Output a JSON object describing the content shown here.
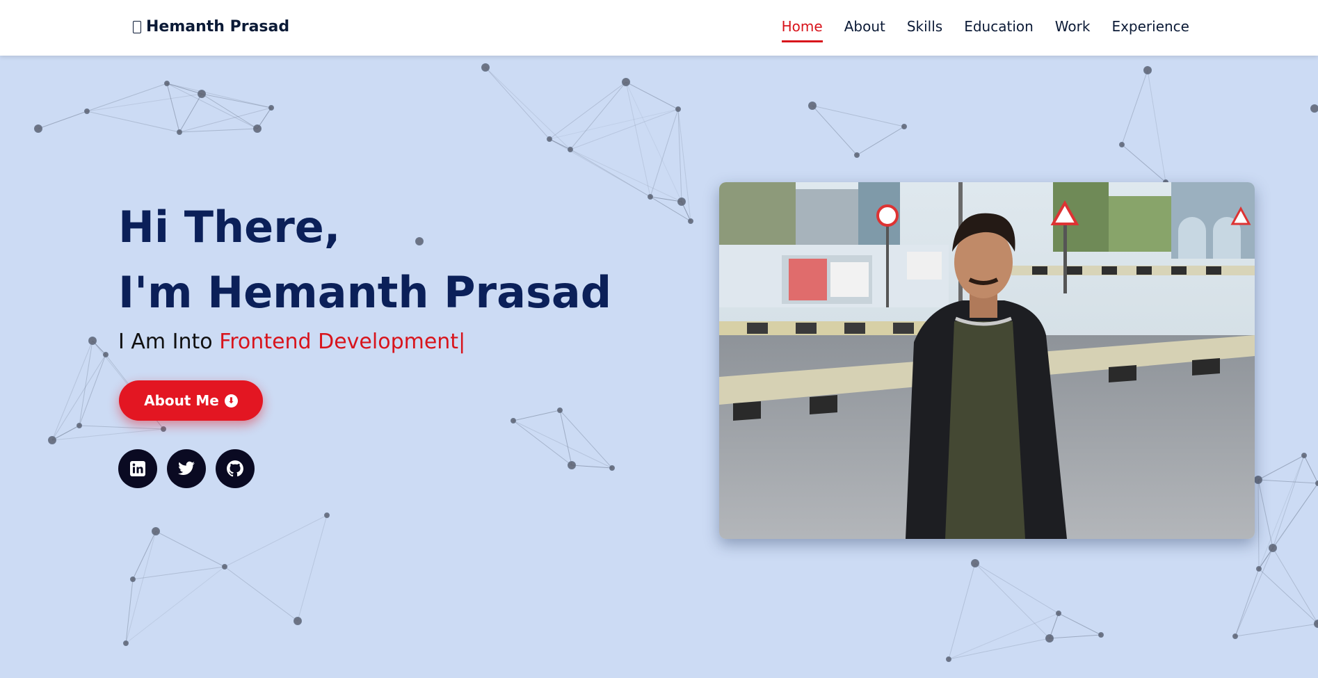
{
  "brand": {
    "icon": "code-icon",
    "name": "Hemanth Prasad"
  },
  "nav": {
    "active": "Home",
    "items": [
      "Home",
      "About",
      "Skills",
      "Education",
      "Work",
      "Experience"
    ]
  },
  "hero": {
    "greeting": "Hi There,",
    "intro": "I'm Hemanth Prasad",
    "prefix": "I Am Into ",
    "role": "Frontend Development",
    "cursor": "|"
  },
  "cta": {
    "label": "About Me",
    "icon": "arrow-down-circle-icon"
  },
  "socials": [
    {
      "name": "linkedin",
      "icon": "linkedin-icon"
    },
    {
      "name": "twitter",
      "icon": "twitter-icon"
    },
    {
      "name": "github",
      "icon": "github-icon"
    }
  ],
  "colors": {
    "background": "#ccdbf4",
    "heading": "#0b2059",
    "accent": "#d8141c",
    "button": "#e31622",
    "social_bg": "#0a0a22",
    "navbar_bg": "#ffffff"
  }
}
